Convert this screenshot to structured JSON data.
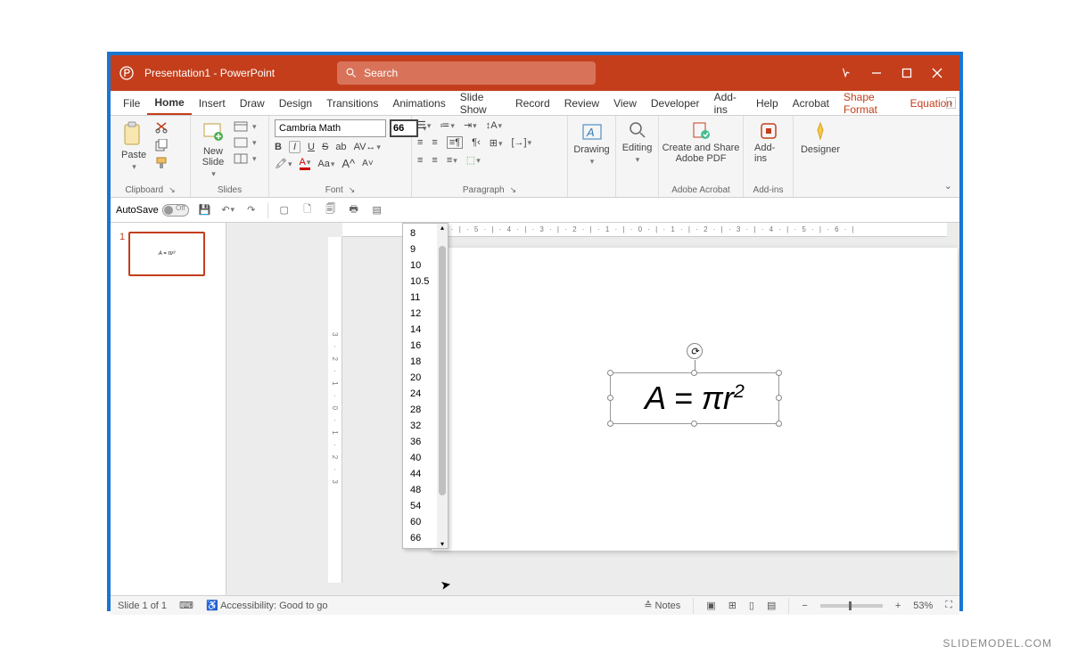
{
  "title": "Presentation1 - PowerPoint",
  "search": {
    "placeholder": "Search"
  },
  "menu": {
    "file": "File",
    "home": "Home",
    "insert": "Insert",
    "draw": "Draw",
    "design": "Design",
    "transitions": "Transitions",
    "animations": "Animations",
    "slideshow": "Slide Show",
    "record": "Record",
    "review": "Review",
    "view": "View",
    "developer": "Developer",
    "addins": "Add-ins",
    "help": "Help",
    "acrobat": "Acrobat",
    "shapeformat": "Shape Format",
    "equation": "Equation"
  },
  "ribbon": {
    "clipboard": {
      "label": "Clipboard",
      "paste": "Paste"
    },
    "slides": {
      "label": "Slides",
      "newslide": "New\nSlide"
    },
    "font": {
      "label": "Font",
      "name": "Cambria Math",
      "size": "66",
      "sizes": [
        "8",
        "9",
        "10",
        "10.5",
        "11",
        "12",
        "14",
        "16",
        "18",
        "20",
        "24",
        "28",
        "32",
        "36",
        "40",
        "44",
        "48",
        "54",
        "60",
        "66"
      ]
    },
    "paragraph": {
      "label": "Paragraph"
    },
    "drawing": {
      "label": "Drawing"
    },
    "editing": {
      "label": "Editing"
    },
    "adobe": {
      "label": "Adobe Acrobat",
      "btn": "Create and Share\nAdobe PDF"
    },
    "addins_g": {
      "label": "Add-ins",
      "btn": "Add-ins"
    },
    "designer": {
      "btn": "Designer"
    }
  },
  "qat": {
    "autosave": "AutoSave",
    "off": "Off"
  },
  "thumb": {
    "num": "1",
    "eq": "A = πr²"
  },
  "equation": "A = πr",
  "equation_sup": "2",
  "ruler_h": "· 6 · | · 5 · | · 4 · | · 3 · | · 2 · | · 1 · | · 0 · | · 1 · | · 2 · | · 3 · | · 4 · | · 5 · | · 6 · |",
  "ruler_v": "3 · 2 · 1 · 0 · 1 · 2 · 3",
  "status": {
    "slide": "Slide 1 of 1",
    "accessibility": "Accessibility: Good to go",
    "notes": "Notes",
    "zoom": "53%"
  },
  "watermark": "SLIDEMODEL.COM"
}
